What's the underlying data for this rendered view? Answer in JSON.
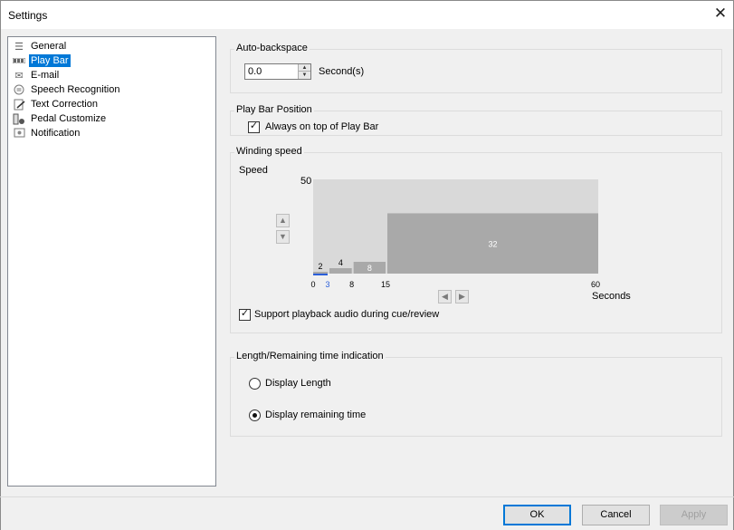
{
  "window": {
    "title": "Settings",
    "close_glyph": "✕"
  },
  "nav": {
    "items": [
      {
        "label": "General",
        "icon": "list-icon",
        "selected": false
      },
      {
        "label": "Play Bar",
        "icon": "playbar-icon",
        "selected": true
      },
      {
        "label": "E-mail",
        "icon": "envelope-icon",
        "selected": false
      },
      {
        "label": "Speech Recognition",
        "icon": "speech-icon",
        "selected": false
      },
      {
        "label": "Text Correction",
        "icon": "edit-document-icon",
        "selected": false
      },
      {
        "label": "Pedal Customize",
        "icon": "pedal-icon",
        "selected": false
      },
      {
        "label": "Notification",
        "icon": "notification-icon",
        "selected": false
      }
    ]
  },
  "auto_backspace": {
    "legend": "Auto-backspace",
    "value": "0.0",
    "unit": "Second(s)"
  },
  "play_bar_position": {
    "legend": "Play Bar Position",
    "always_on_top_label": "Always on top of Play Bar",
    "always_on_top_checked": true
  },
  "winding_speed": {
    "legend": "Winding speed",
    "speed_label": "Speed",
    "speed_max": "50",
    "seconds_label": "Seconds",
    "support_playback_label": "Support playback audio during cue/review",
    "support_playback_checked": true,
    "x_ticks": [
      "0",
      "3",
      "8",
      "15",
      "60"
    ],
    "bar_labels": [
      "2",
      "4",
      "8",
      "32"
    ],
    "bars": [
      {
        "from_sec": 0,
        "to_sec": 3,
        "speed": 2
      },
      {
        "from_sec": 3,
        "to_sec": 8,
        "speed": 4
      },
      {
        "from_sec": 8,
        "to_sec": 15,
        "speed": 8
      },
      {
        "from_sec": 15,
        "to_sec": 60,
        "speed": 32
      }
    ],
    "selected_tick": "3",
    "colors": {
      "plot_bg": "#d9d9d9",
      "bar": "#a9a9a9",
      "selected_line": "#2b5fd9",
      "selected_tick": "#2b5fd9"
    }
  },
  "length_indication": {
    "legend": "Length/Remaining time indication",
    "options": [
      {
        "label": "Display Length",
        "selected": false
      },
      {
        "label": "Display remaining time",
        "selected": true
      }
    ]
  },
  "footer": {
    "ok": "OK",
    "cancel": "Cancel",
    "apply": "Apply"
  }
}
